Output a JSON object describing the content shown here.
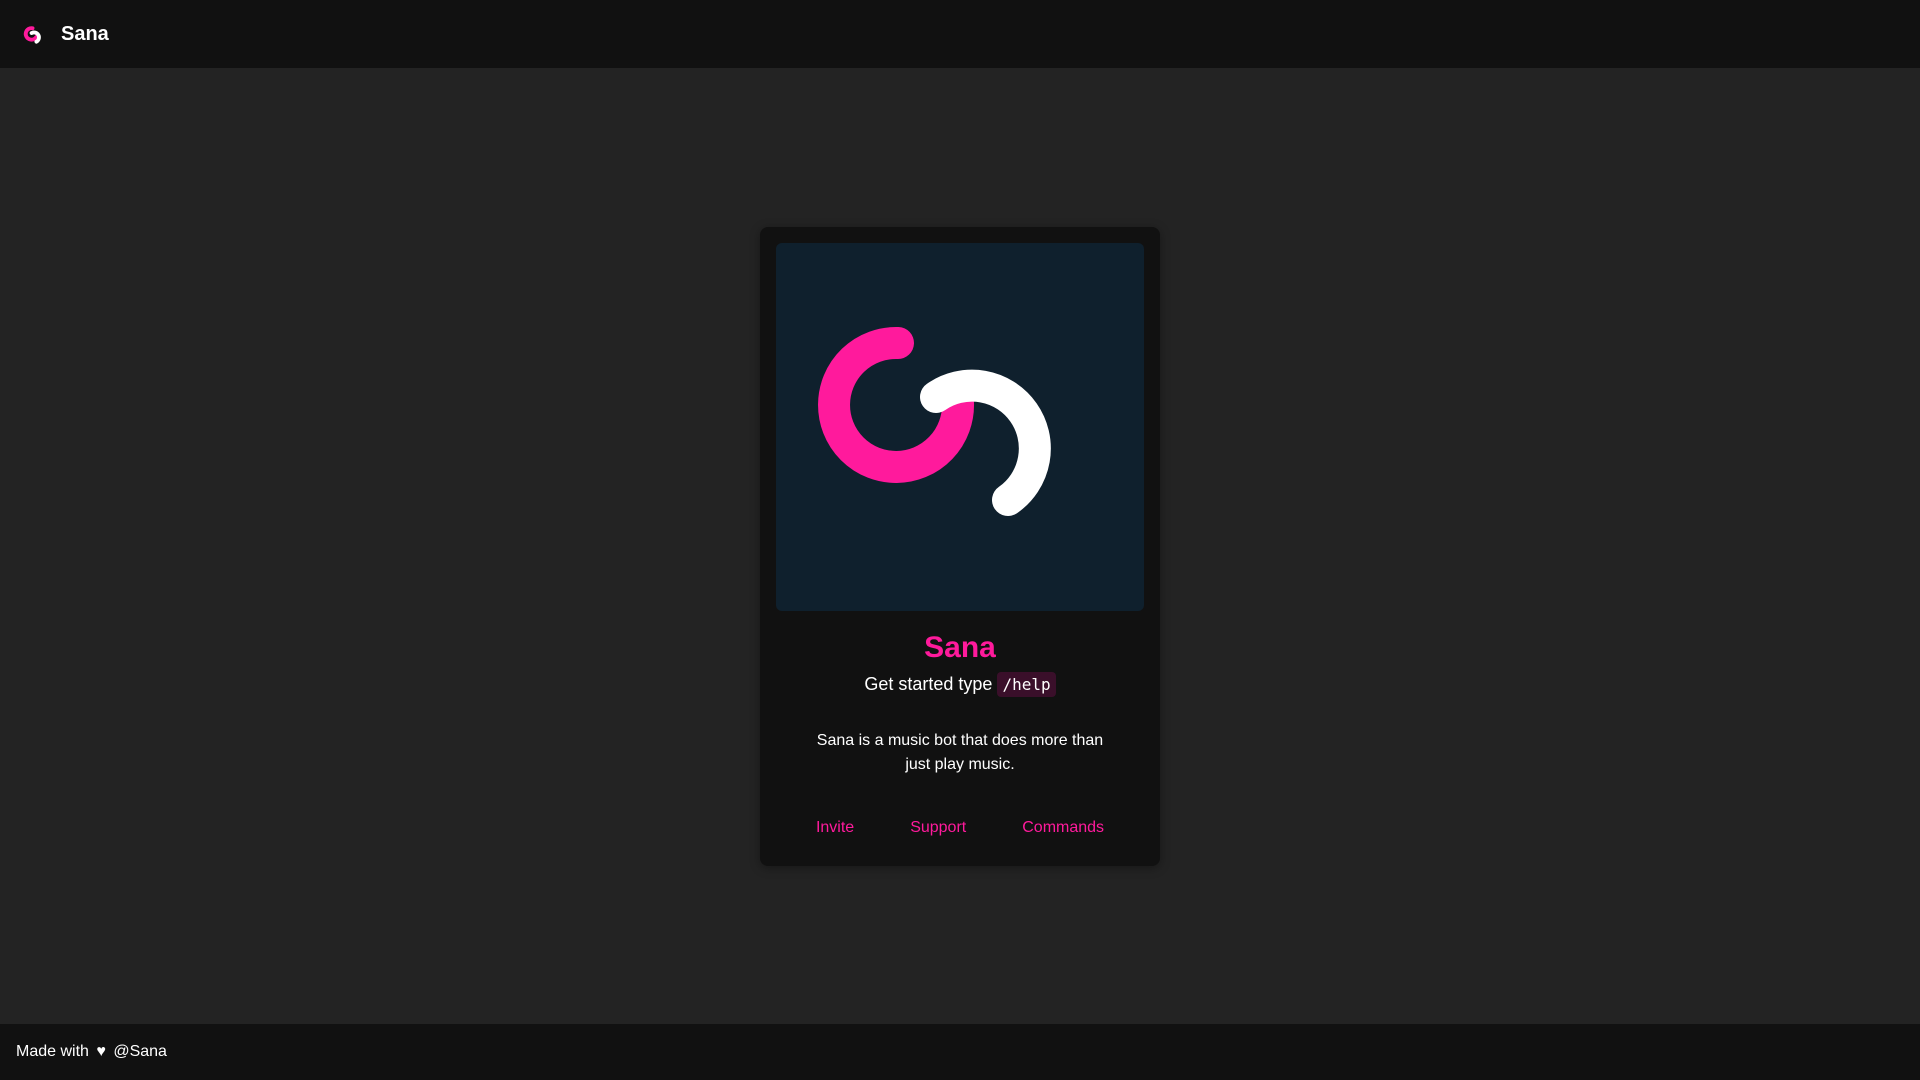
{
  "header": {
    "brand_name": "Sana",
    "logo_icon": "sana-swirl-logo-icon"
  },
  "card": {
    "title": "Sana",
    "getstarted_prefix": "Get started type",
    "command": "/help",
    "description": "Sana is a music bot that does more than just play music.",
    "links": [
      {
        "label": "Invite"
      },
      {
        "label": "Support"
      },
      {
        "label": "Commands"
      }
    ]
  },
  "footer": {
    "made_with": "Made with",
    "heart": "♥",
    "handle": "@Sana"
  },
  "colors": {
    "accent": "#ff1a9c",
    "page_background": "#232323",
    "bar_background": "#111111",
    "card_background": "#111111",
    "image_background": "#0f202d",
    "code_background": "#3a0f2a"
  }
}
